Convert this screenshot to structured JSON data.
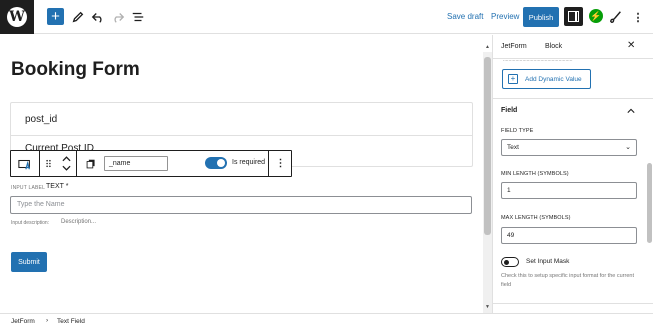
{
  "topbar": {
    "add_icon": "plus-icon",
    "save_draft": "Save draft",
    "preview": "Preview",
    "publish": "Publish",
    "jetpack_symbol": "⚡",
    "more": "⋮"
  },
  "editor": {
    "title": "Booking Form",
    "block_fields": [
      "post_id",
      "Current Post ID"
    ],
    "toolbar": {
      "name_value": "_name",
      "is_required_label": "Is required",
      "more": "⋮"
    },
    "input_label": "INPUT LABEL",
    "input_label_value": "TEXT *",
    "name_placeholder": "Type the Name",
    "input_description": "Input description:",
    "description_placeholder": "Description...",
    "submit_label": "Submit"
  },
  "sidebar": {
    "tabs": [
      "JetForm",
      "Block"
    ],
    "close": "✕",
    "cutoff_text": "..................................................",
    "add_dynamic": "Add Dynamic Value",
    "field_section": "Field",
    "field_type_label": "FIELD TYPE",
    "field_type_value": "Text",
    "min_length_label": "MIN LENGTH (SYMBOLS)",
    "min_length_value": "1",
    "max_length_label": "MAX LENGTH (SYMBOLS)",
    "max_length_value": "49",
    "set_input_mask": "Set Input Mask",
    "mask_help": "Check this to setup specific input format for the current field"
  },
  "footer": {
    "breadcrumbs": [
      "JetForm",
      "Text Field"
    ],
    "separator": "›"
  },
  "colors": {
    "accent": "#2271b1",
    "dark": "#1e1e1e",
    "jetpack": "#069e08"
  }
}
